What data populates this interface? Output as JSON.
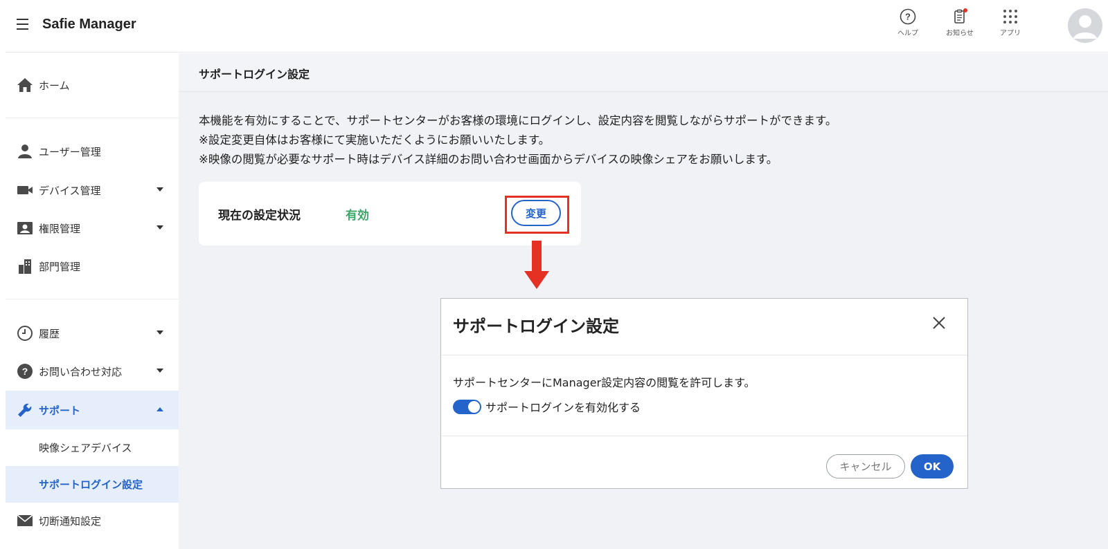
{
  "header": {
    "brand": "Safie Manager",
    "help_label": "ヘルプ",
    "notices_label": "お知らせ",
    "apps_label": "アプリ"
  },
  "sidebar": {
    "home": "ホーム",
    "user_management": "ユーザー管理",
    "device_management": "デバイス管理",
    "permission_management": "権限管理",
    "department_management": "部門管理",
    "history": "履歴",
    "inquiry": "お問い合わせ対応",
    "support": "サポート",
    "support_sub": [
      "映像シェアデバイス",
      "サポートログイン設定"
    ],
    "disconnect_notice": "切断通知設定"
  },
  "main": {
    "title": "サポートログイン設定",
    "description": [
      "本機能を有効にすることで、サポートセンターがお客様の環境にログインし、設定内容を閲覧しながらサポートができます。",
      "※設定変更自体はお客様にて実施いただくようにお願いいたします。",
      "※映像の閲覧が必要なサポート時はデバイス詳細のお問い合わせ画面からデバイスの映像シェアをお願いします。"
    ],
    "status_label": "現在の設定状況",
    "status_value": "有効",
    "change_button": "変更"
  },
  "dialog": {
    "title": "サポートログイン設定",
    "text": "サポートセンターにManager設定内容の閲覧を許可します。",
    "toggle_label": "サポートログインを有効化する",
    "toggle_on": true,
    "cancel": "キャンセル",
    "ok": "OK"
  },
  "colors": {
    "accent": "#2463c9",
    "status_green": "#3ea569",
    "highlight_red": "#e53024"
  }
}
